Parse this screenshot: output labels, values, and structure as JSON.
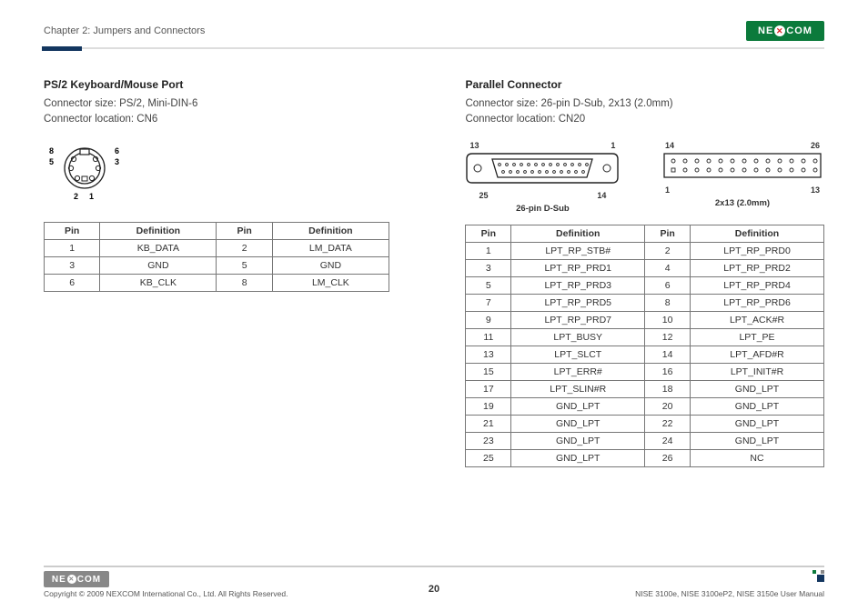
{
  "header": {
    "chapter": "Chapter 2: Jumpers and Connectors",
    "logo": "NEXCOM"
  },
  "left": {
    "title": "PS/2 Keyboard/Mouse Port",
    "line1": "Connector size: PS/2, Mini-DIN-6",
    "line2": "Connector location: CN6",
    "pinlabels": {
      "p1": "1",
      "p2": "2",
      "p3": "3",
      "p5": "5",
      "p6": "6",
      "p8": "8"
    },
    "table": {
      "h1": "Pin",
      "h2": "Definition",
      "h3": "Pin",
      "h4": "Definition",
      "rows": [
        {
          "a": "1",
          "b": "KB_DATA",
          "c": "2",
          "d": "LM_DATA"
        },
        {
          "a": "3",
          "b": "GND",
          "c": "5",
          "d": "GND"
        },
        {
          "a": "6",
          "b": "KB_CLK",
          "c": "8",
          "d": "LM_CLK"
        }
      ]
    }
  },
  "right": {
    "title": "Parallel Connector",
    "line1": "Connector size:  26-pin D-Sub, 2x13 (2.0mm)",
    "line2": "Connector location: CN20",
    "fig1": {
      "tl": "13",
      "tr": "1",
      "bl": "25",
      "br": "14",
      "cap": "26-pin D-Sub"
    },
    "fig2": {
      "tl": "14",
      "tr": "26",
      "bl": "1",
      "br": "13",
      "cap": "2x13 (2.0mm)"
    },
    "table": {
      "h1": "Pin",
      "h2": "Definition",
      "h3": "Pin",
      "h4": "Definition",
      "rows": [
        {
          "a": "1",
          "b": "LPT_RP_STB#",
          "c": "2",
          "d": "LPT_RP_PRD0"
        },
        {
          "a": "3",
          "b": "LPT_RP_PRD1",
          "c": "4",
          "d": "LPT_RP_PRD2"
        },
        {
          "a": "5",
          "b": "LPT_RP_PRD3",
          "c": "6",
          "d": "LPT_RP_PRD4"
        },
        {
          "a": "7",
          "b": "LPT_RP_PRD5",
          "c": "8",
          "d": "LPT_RP_PRD6"
        },
        {
          "a": "9",
          "b": "LPT_RP_PRD7",
          "c": "10",
          "d": "LPT_ACK#R"
        },
        {
          "a": "11",
          "b": "LPT_BUSY",
          "c": "12",
          "d": "LPT_PE"
        },
        {
          "a": "13",
          "b": "LPT_SLCT",
          "c": "14",
          "d": "LPT_AFD#R"
        },
        {
          "a": "15",
          "b": "LPT_ERR#",
          "c": "16",
          "d": "LPT_INIT#R"
        },
        {
          "a": "17",
          "b": "LPT_SLIN#R",
          "c": "18",
          "d": "GND_LPT"
        },
        {
          "a": "19",
          "b": "GND_LPT",
          "c": "20",
          "d": "GND_LPT"
        },
        {
          "a": "21",
          "b": "GND_LPT",
          "c": "22",
          "d": "GND_LPT"
        },
        {
          "a": "23",
          "b": "GND_LPT",
          "c": "24",
          "d": "GND_LPT"
        },
        {
          "a": "25",
          "b": "GND_LPT",
          "c": "26",
          "d": "NC"
        }
      ]
    }
  },
  "footer": {
    "logo": "NEXCOM",
    "copyright": "Copyright © 2009 NEXCOM International Co., Ltd. All Rights Reserved.",
    "page": "20",
    "manual": "NISE 3100e, NISE 3100eP2, NISE 3150e User Manual"
  }
}
